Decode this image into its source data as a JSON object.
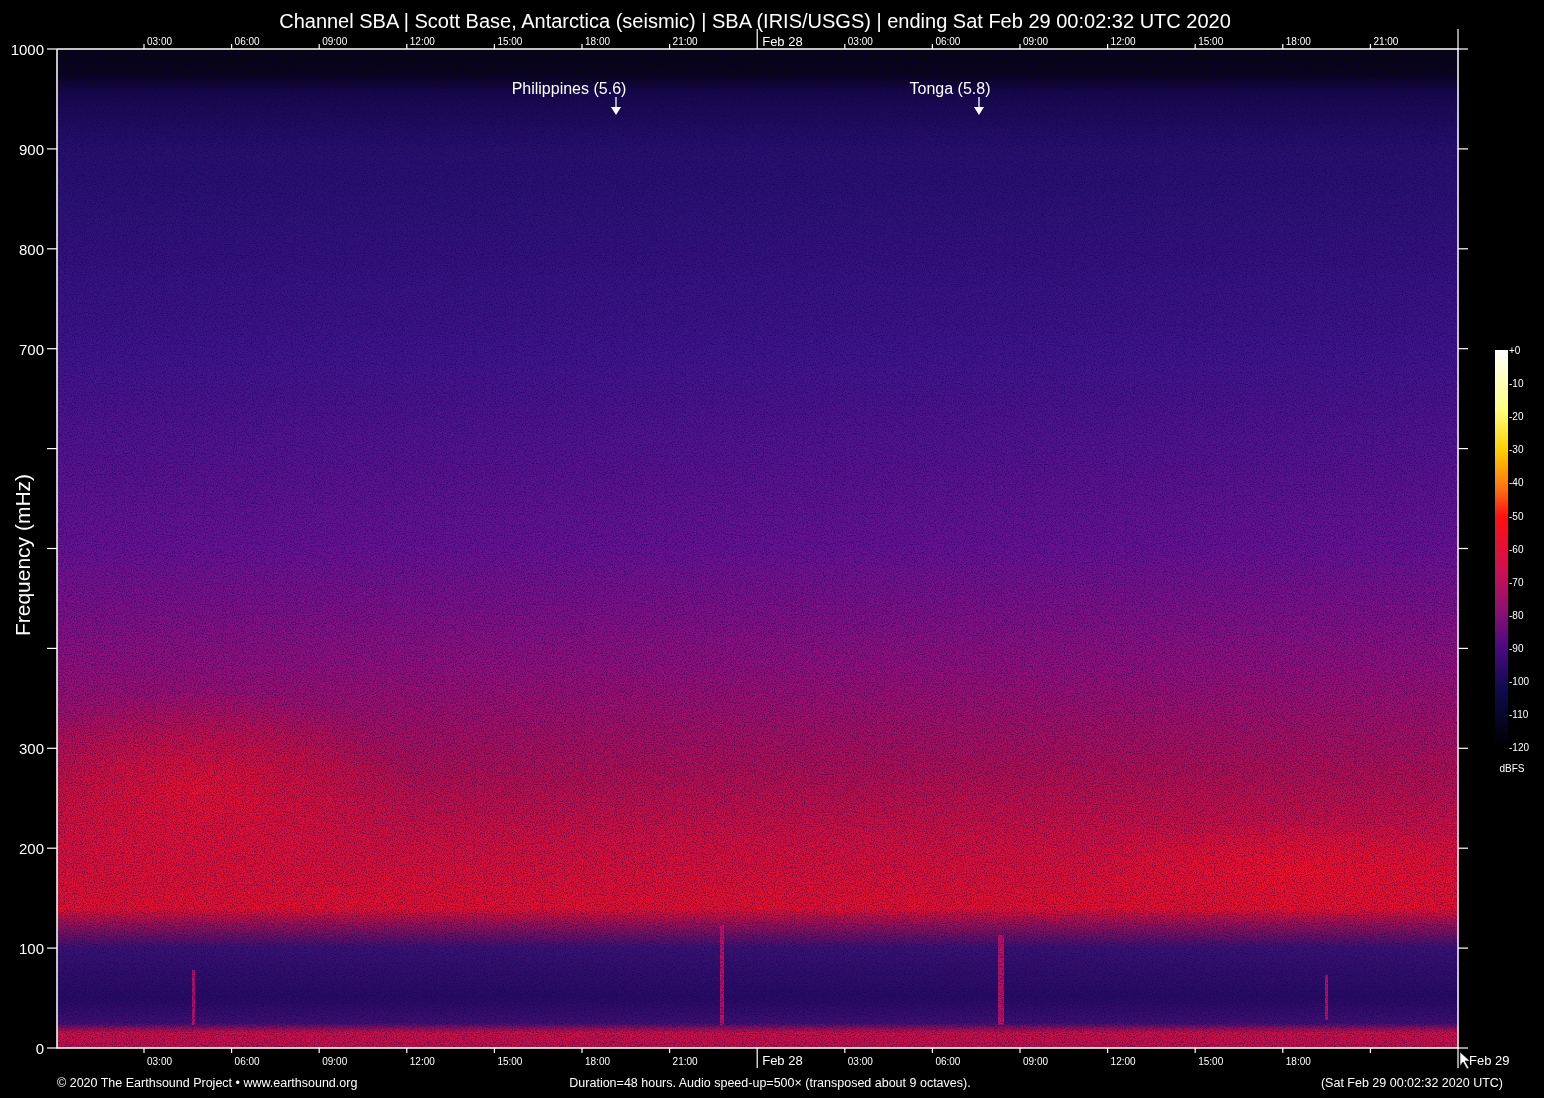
{
  "title": "Channel SBA | Scott Base, Antarctica (seismic) | SBA (IRIS/USGS) | ending Sat Feb 29 00:02:32 UTC 2020",
  "y_axis": {
    "title": "Frequency (mHz)",
    "ticks": [
      {
        "kind": "labeled",
        "label": "1000"
      },
      {
        "kind": "labeled",
        "label": "900"
      },
      {
        "kind": "labeled",
        "label": "800"
      },
      {
        "kind": "labeled",
        "label": "700"
      },
      {
        "kind": "minor"
      },
      {
        "kind": "minor"
      },
      {
        "kind": "minor"
      },
      {
        "kind": "labeled",
        "label": "300"
      },
      {
        "kind": "labeled",
        "label": "200"
      },
      {
        "kind": "labeled",
        "label": "100"
      },
      {
        "kind": "labeled",
        "label": "0"
      }
    ]
  },
  "top_axis": {
    "ticks": [
      {
        "kind": "time",
        "label": "03:00"
      },
      {
        "kind": "time",
        "label": "06:00"
      },
      {
        "kind": "time",
        "label": "09:00"
      },
      {
        "kind": "time",
        "label": "12:00"
      },
      {
        "kind": "time",
        "label": "15:00"
      },
      {
        "kind": "time",
        "label": "18:00"
      },
      {
        "kind": "time",
        "label": "21:00"
      },
      {
        "kind": "date",
        "label": "Feb 28"
      },
      {
        "kind": "time",
        "label": "03:00"
      },
      {
        "kind": "time",
        "label": "06:00"
      },
      {
        "kind": "time",
        "label": "09:00"
      },
      {
        "kind": "time",
        "label": "12:00"
      },
      {
        "kind": "time",
        "label": "15:00"
      },
      {
        "kind": "time",
        "label": "18:00"
      },
      {
        "kind": "time",
        "label": "21:00"
      },
      {
        "kind": "end"
      }
    ]
  },
  "bottom_axis": {
    "ticks": [
      {
        "kind": "time",
        "label": "03:00"
      },
      {
        "kind": "time",
        "label": "06:00"
      },
      {
        "kind": "time",
        "label": "09:00"
      },
      {
        "kind": "time",
        "label": "12:00"
      },
      {
        "kind": "time",
        "label": "15:00"
      },
      {
        "kind": "time",
        "label": "18:00"
      },
      {
        "kind": "time",
        "label": "21:00"
      },
      {
        "kind": "date",
        "label": "Feb 28"
      },
      {
        "kind": "time",
        "label": "03:00"
      },
      {
        "kind": "time",
        "label": "06:00"
      },
      {
        "kind": "time",
        "label": "09:00"
      },
      {
        "kind": "time",
        "label": "12:00"
      },
      {
        "kind": "time",
        "label": "15:00"
      },
      {
        "kind": "time",
        "label": "18:00"
      },
      {
        "kind": "minor"
      },
      {
        "kind": "date",
        "label": "Feb 29"
      }
    ]
  },
  "events": [
    {
      "label": "Philippines (5.6)"
    },
    {
      "label": "Tonga (5.8)"
    }
  ],
  "colorbar": {
    "labels": [
      "+0",
      "-10",
      "-20",
      "-30",
      "-40",
      "-50",
      "-60",
      "-70",
      "-80",
      "-90",
      "-100",
      "-110",
      "-120"
    ],
    "unit": "dBFS"
  },
  "footer": {
    "left": "© 2020 The Earthsound Project • www.earthsound.org",
    "center": "Duration=48 hours. Audio speed-up=500× (transposed about 9 octaves).",
    "right": "(Sat Feb 29 00:02:32 2020 UTC)"
  }
}
